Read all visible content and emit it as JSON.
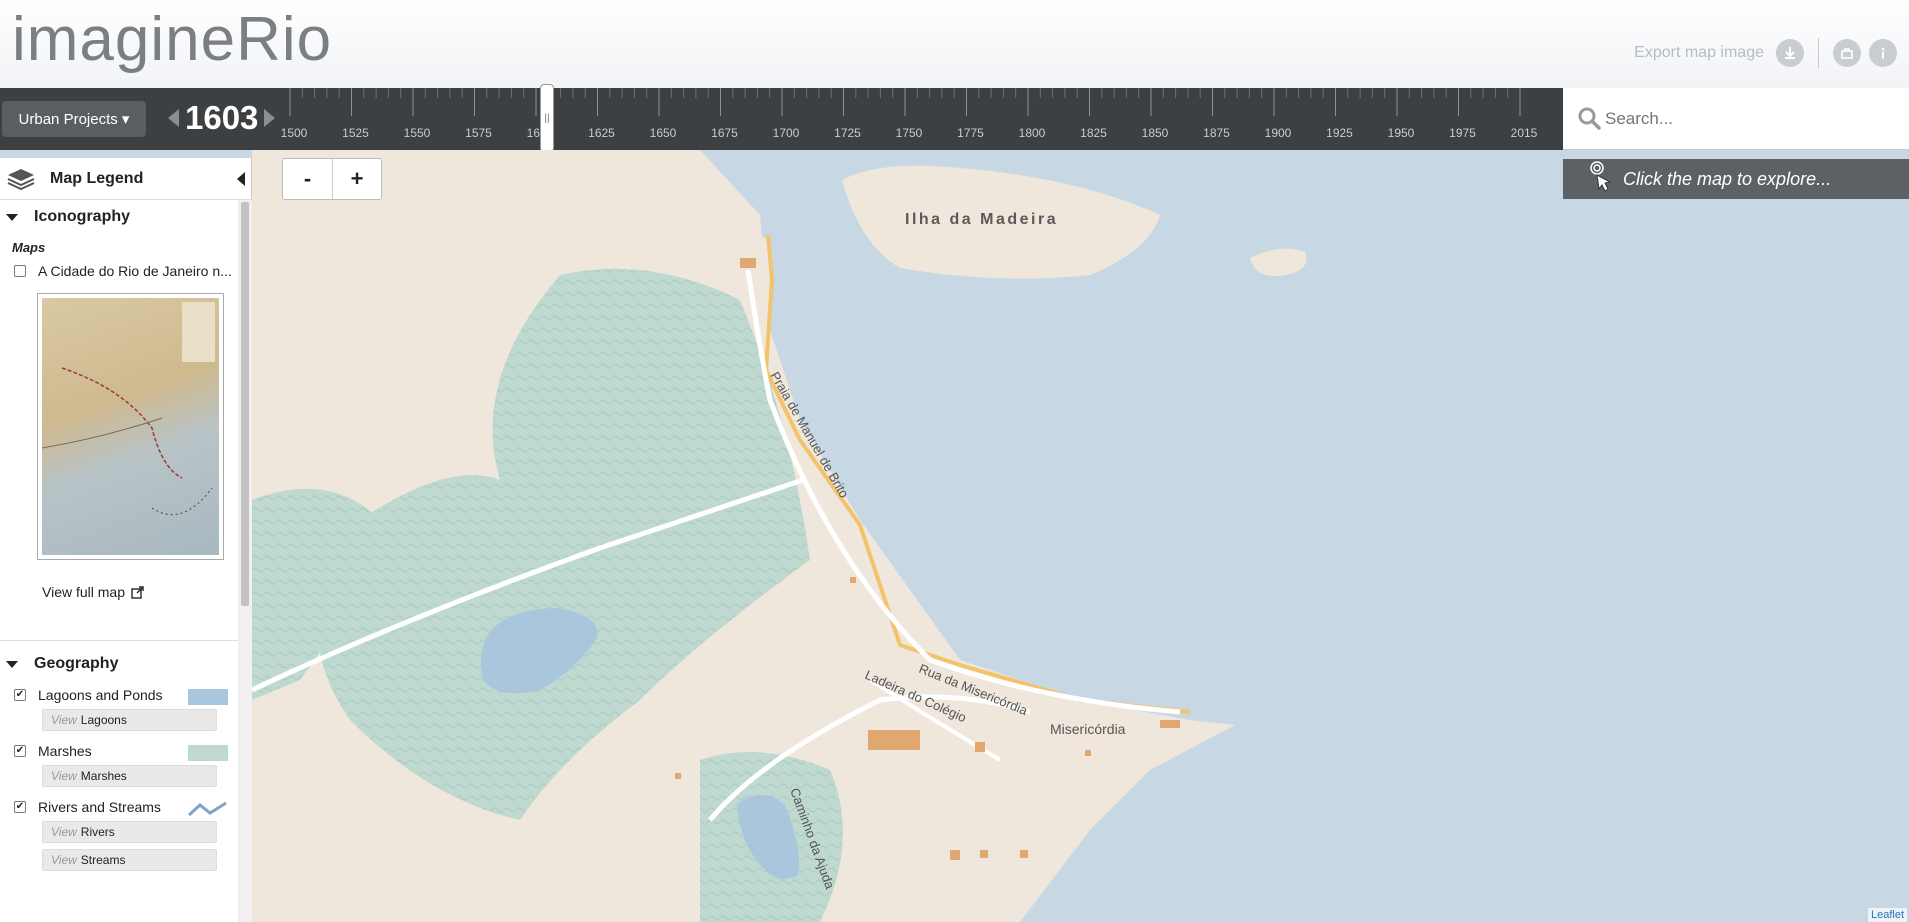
{
  "app": {
    "logo": "imagineRio"
  },
  "header": {
    "export_label": "Export map image"
  },
  "timeline": {
    "projects_label": "Urban Projects ▾",
    "year": "1603",
    "ticks": [
      "1500",
      "1525",
      "1550",
      "1575",
      "1600",
      "1625",
      "1650",
      "1675",
      "1700",
      "1725",
      "1750",
      "1775",
      "1800",
      "1825",
      "1850",
      "1875",
      "1900",
      "1925",
      "1950",
      "1975",
      "2015"
    ],
    "handle_glyph": "||"
  },
  "search": {
    "placeholder": "Search..."
  },
  "explore": {
    "label": "Click the map to explore..."
  },
  "zoom": {
    "out_label": "-",
    "in_label": "+"
  },
  "legend": {
    "title": "Map Legend",
    "iconography": {
      "heading": "Iconography",
      "subheading": "Maps",
      "map_item": "A Cidade do Rio de Janeiro n...",
      "view_full": "View full map"
    },
    "geography": {
      "heading": "Geography",
      "view_prefix": "View",
      "layers": [
        {
          "label": "Lagoons and Ponds",
          "checked": true,
          "views": [
            "Lagoons"
          ]
        },
        {
          "label": "Marshes",
          "checked": true,
          "views": [
            "Marshes"
          ]
        },
        {
          "label": "Rivers and Streams",
          "checked": true,
          "views": [
            "Rivers",
            "Streams"
          ]
        }
      ]
    }
  },
  "map_labels": {
    "island": "Ilha da Madeira",
    "praia": "Praia de Manuel de Brito",
    "rua": "Rua da Misericórdia",
    "ladeira": "Ladeira do Colégio",
    "misericordia": "Misericórdia",
    "caminho": "Caminho da Ajuda"
  },
  "attribution": "Leaflet",
  "colors": {
    "water": "#c7d8e4",
    "land": "#efe7dc",
    "marsh": "#bcd7cf",
    "shore": "#f2c36b",
    "building": "#e0a870"
  }
}
